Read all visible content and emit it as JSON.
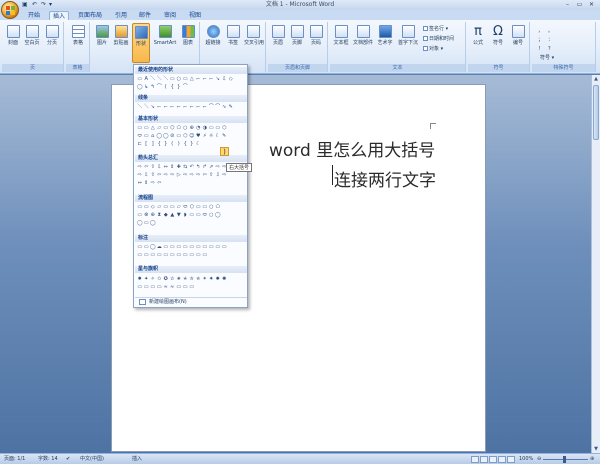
{
  "window": {
    "title": "文档 1 - Microsoft Word",
    "qat_save": "▣",
    "qat_undo": "↶",
    "qat_redo": "↷",
    "qat_more": "▾",
    "minimize": "–",
    "restore": "▭",
    "close": "✕"
  },
  "tabs": [
    "开始",
    "插入",
    "页面布局",
    "引用",
    "邮件",
    "审阅",
    "视图"
  ],
  "ribbon": {
    "pages_group": {
      "label": "页",
      "buttons": [
        "封面",
        "空白页",
        "分页"
      ]
    },
    "table_group": {
      "label": "表格",
      "buttons": [
        "表格"
      ]
    },
    "illus_buttons": [
      "图片",
      "剪贴画",
      "形状",
      "SmartArt",
      "图表"
    ],
    "links_buttons": [
      "超链接",
      "书签",
      "交叉引用"
    ],
    "header_group": {
      "label": "页眉和页脚",
      "buttons": [
        "页眉",
        "页脚",
        "页码"
      ]
    },
    "text_group": {
      "label": "文本",
      "buttons": [
        "文本框",
        "文档部件",
        "艺术字",
        "首字下沉"
      ],
      "small": [
        "签名行 ▾",
        "日期和时间",
        "对象 ▾"
      ]
    },
    "symbol_group": {
      "label": "符号",
      "buttons": [
        "公式",
        "符号",
        "编号"
      ]
    },
    "special_group": {
      "label": "特殊符号",
      "items": [
        "，",
        "。",
        "；",
        "：",
        "！",
        "？",
        "符号 ▾"
      ]
    }
  },
  "shapes_panel": {
    "categories": [
      "最近使用的形状",
      "线条",
      "基本形状",
      "箭头总汇",
      "流程图",
      "标注",
      "星与旗帜"
    ],
    "recent_rows": [
      [
        "▭",
        "A",
        "＼",
        "＼",
        "＼",
        "▭",
        "○",
        "▭",
        "△",
        "⌐",
        "⌐",
        "⌐",
        "↘",
        "⇩",
        "◇"
      ],
      [
        "◯",
        "↳",
        "↰",
        "⌒",
        "(",
        "{",
        "}",
        "⌒"
      ]
    ],
    "lines_rows": [
      [
        "＼",
        "＼",
        "↘",
        "⌐",
        "⌐",
        "⌐",
        "⌐",
        "⌐",
        "⌐",
        "⌐",
        "⌐",
        "⌒",
        "⌒",
        "∿",
        "✎"
      ]
    ],
    "basic_rows": [
      [
        "▭",
        "▭",
        "△",
        "▱",
        "▭",
        "⬡",
        "⬠",
        "○",
        "⊕",
        "◔",
        "◑",
        "▭",
        "▭",
        "⬡"
      ],
      [
        "⬭",
        "▭",
        "⌂",
        "◯",
        "◯",
        "⊘",
        "▭",
        "⬡",
        "☺",
        "♥",
        "⚡",
        "☼",
        "☾",
        "✎"
      ],
      [
        "⊏",
        "[",
        "]",
        "{",
        "}",
        "(",
        ")",
        "{",
        "}",
        "☾"
      ]
    ],
    "arrow_rows": [
      [
        "⇨",
        "⇦",
        "⇧",
        "⇩",
        "⇔",
        "⇕",
        "✚",
        "⇆",
        "↶",
        "↰",
        "↱",
        "⇗",
        "⇨",
        "⇨"
      ],
      [
        "⇨",
        "⇩",
        "⇧",
        "⇦",
        "⇨",
        "⇨",
        "▷",
        "⇨",
        "⇨",
        "⇨",
        "⇦",
        "⇧",
        "⇩",
        "⇨"
      ],
      [
        "⇔",
        "⇕",
        "⇨",
        "⇦"
      ]
    ],
    "flow_rows": [
      [
        "▭",
        "▭",
        "◇",
        "▱",
        "▭",
        "▭",
        "▱",
        "⬭",
        "⬡",
        "▭",
        "▭",
        "○",
        "⬠"
      ],
      [
        "▭",
        "⊗",
        "⊕",
        "⧗",
        "◆",
        "▲",
        "▼",
        "◗",
        "▭",
        "▭",
        "⬭",
        "○",
        "◯"
      ],
      [
        "◯",
        "▭",
        "◯"
      ]
    ],
    "callout_rows": [
      [
        "▭",
        "▭",
        "◯",
        "☁",
        "▭",
        "▭",
        "▭",
        "▭",
        "▭",
        "▭",
        "▭",
        "▭",
        "▭",
        "▭"
      ],
      [
        "▭",
        "▭",
        "▭",
        "▭",
        "▭",
        "▭",
        "▭",
        "▭",
        "▭",
        "▭",
        "▭"
      ]
    ],
    "star_rows": [
      [
        "✸",
        "✦",
        "✧",
        "✩",
        "✪",
        "✫",
        "✬",
        "✭",
        "✮",
        "✯",
        "✶",
        "✷",
        "✹",
        "✺"
      ],
      [
        "▭",
        "▭",
        "▭",
        "▭",
        "≈",
        "≈",
        "▭",
        "▭",
        "▭"
      ]
    ],
    "hover_shape": ")",
    "tooltip": "右大括号",
    "new_canvas": "新建绘图画布(N)"
  },
  "document": {
    "line1": "word 里怎么用大括号",
    "line2": "连接两行文字"
  },
  "status": {
    "page": "页面: 1/1",
    "words": "字数: 14",
    "language": "中文(中国)",
    "mode": "插入",
    "zoom": "100%"
  }
}
